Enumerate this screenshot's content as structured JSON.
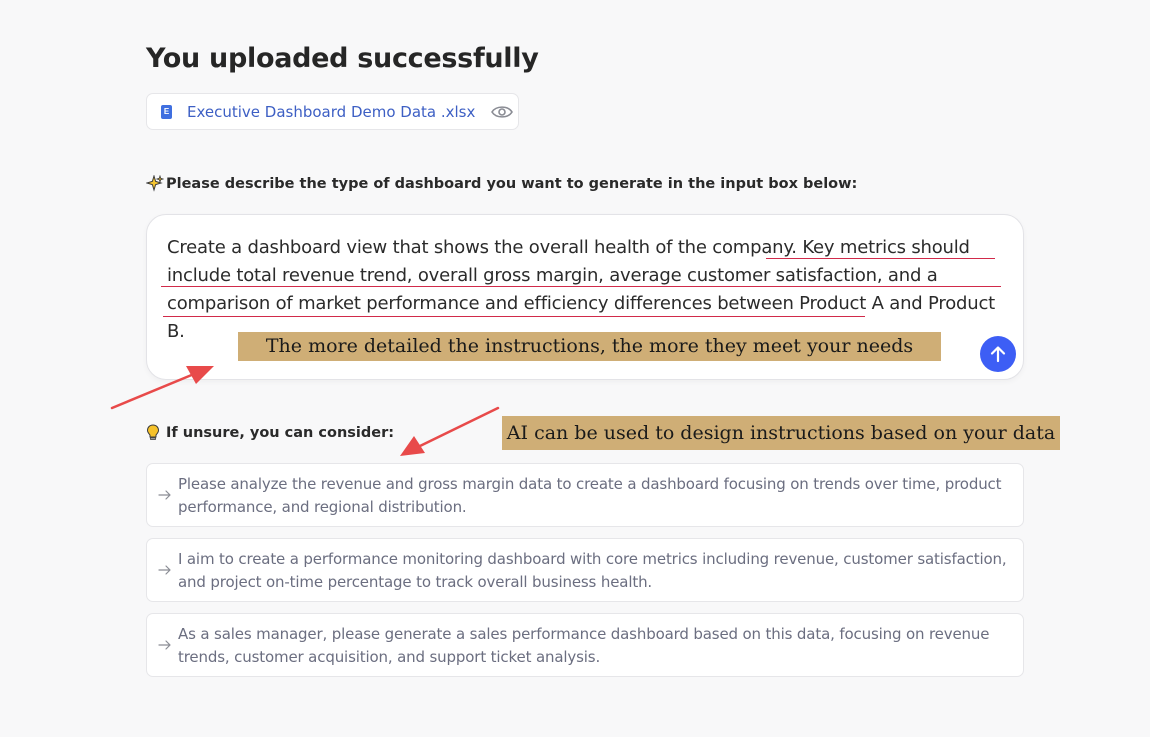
{
  "page": {
    "title": "You uploaded successfully"
  },
  "file": {
    "icon_letter": "E",
    "name": "Executive Dashboard Demo Data .xlsx"
  },
  "prompt": {
    "label": "Please describe the type of dashboard you want to generate in the input box below:",
    "value": "Create a dashboard view that shows the overall health of the company. Key metrics should include total revenue trend, overall gross margin, average customer satisfaction, and a comparison of market performance and efficiency differences between Product A and Product B."
  },
  "annotations": {
    "detail_tip": "The more detailed the instructions, the more they meet your needs",
    "ai_tip": "AI can be used to design instructions based on your data"
  },
  "suggestions": {
    "label": "If unsure, you can consider:",
    "items": [
      "Please analyze the revenue and gross margin data to create a dashboard focusing on trends over time, product performance, and regional distribution.",
      "I aim to create a performance monitoring dashboard with core metrics including revenue, customer satisfaction, and project on-time percentage to track overall business health.",
      "As a sales manager, please generate a sales performance dashboard based on this data, focusing on revenue trends, customer acquisition, and support ticket analysis."
    ]
  },
  "colors": {
    "accent": "#3d5ef5",
    "annotation_bg": "#cfae76",
    "underline": "#d12a4a",
    "callout_arrow": "#e84a4a"
  },
  "icons": {
    "file": "excel-file-icon",
    "preview": "eye-icon",
    "prompt": "sparkle-icon",
    "send": "arrow-up-icon",
    "consider": "lightbulb-icon",
    "suggestion": "arrow-right-icon"
  }
}
